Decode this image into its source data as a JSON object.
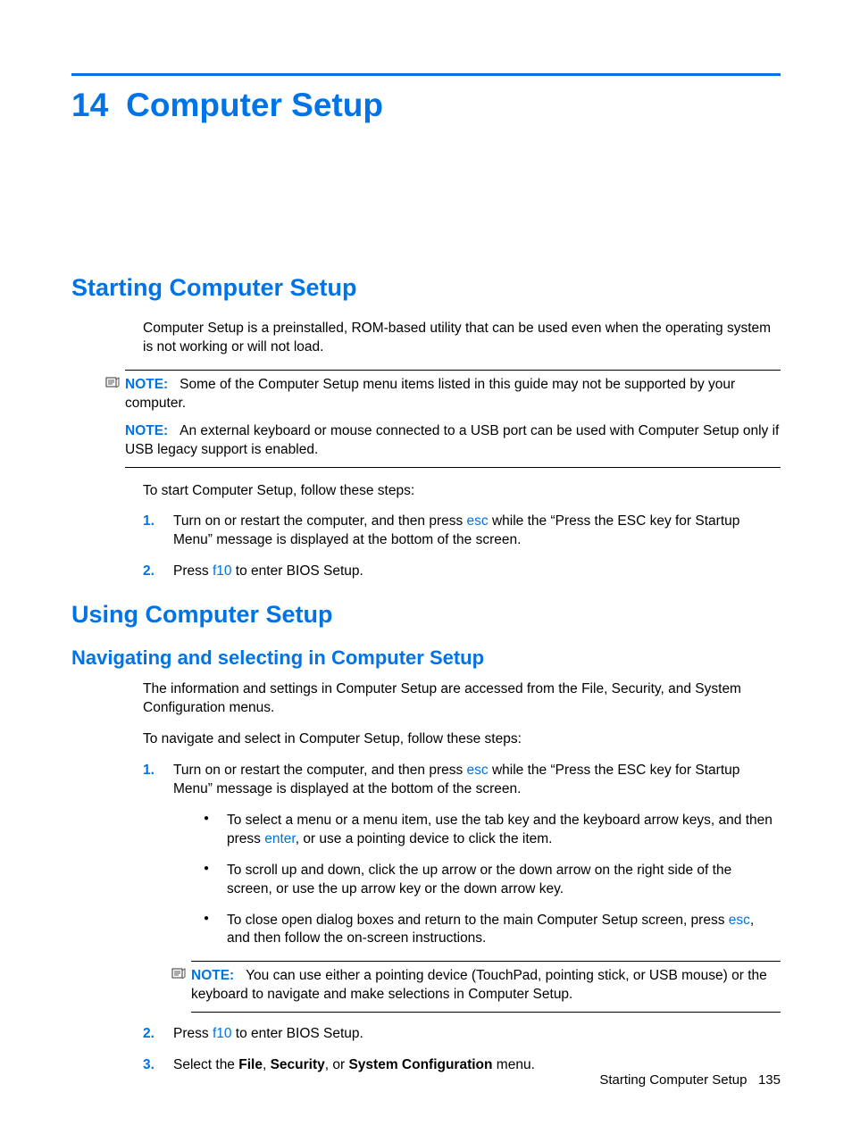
{
  "chapter": {
    "num": "14",
    "title": "Computer Setup"
  },
  "s1": {
    "heading": "Starting Computer Setup",
    "p1": "Computer Setup is a preinstalled, ROM-based utility that can be used even when the operating system is not working or will not load.",
    "noteLabel": "NOTE:",
    "note1": "Some of the Computer Setup menu items listed in this guide may not be supported by your computer.",
    "note2": "An external keyboard or mouse connected to a USB port can be used with Computer Setup only if USB legacy support is enabled.",
    "p2": "To start Computer Setup, follow these steps:",
    "step1a": "Turn on or restart the computer, and then press ",
    "step1key": "esc",
    "step1b": " while the “Press the ESC key for Startup Menu” message is displayed at the bottom of the screen.",
    "step2a": "Press ",
    "step2key": "f10",
    "step2b": " to enter BIOS Setup."
  },
  "s2": {
    "heading": "Using Computer Setup",
    "sub": "Navigating and selecting in Computer Setup",
    "p1": "The information and settings in Computer Setup are accessed from the File, Security, and System Configuration menus.",
    "p2": "To navigate and select in Computer Setup, follow these steps:",
    "step1a": "Turn on or restart the computer, and then press ",
    "step1key": "esc",
    "step1b": " while the “Press the ESC key for Startup Menu” message is displayed at the bottom of the screen.",
    "b1a": "To select a menu or a menu item, use the tab key and the keyboard arrow keys, and then press ",
    "b1key": "enter",
    "b1b": ", or use a pointing device to click the item.",
    "b2": "To scroll up and down, click the up arrow or the down arrow on the right side of the screen, or use the up arrow key or the down arrow key.",
    "b3a": "To close open dialog boxes and return to the main Computer Setup screen, press ",
    "b3key": "esc",
    "b3b": ", and then follow the on-screen instructions.",
    "noteLabel": "NOTE:",
    "note": "You can use either a pointing device (TouchPad, pointing stick, or USB mouse) or the keyboard to navigate and make selections in Computer Setup.",
    "step2a": "Press ",
    "step2key": "f10",
    "step2b": " to enter BIOS Setup.",
    "step3a": "Select the ",
    "step3w1": "File",
    "step3c1": ", ",
    "step3w2": "Security",
    "step3c2": ", or ",
    "step3w3": "System Configuration",
    "step3b": " menu."
  },
  "nums": {
    "n1": "1.",
    "n2": "2.",
    "n3": "3."
  },
  "footer": {
    "section": "Starting Computer Setup",
    "page": "135"
  }
}
